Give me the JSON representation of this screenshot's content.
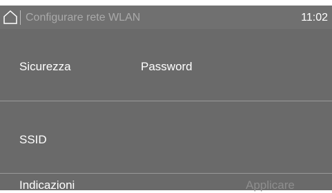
{
  "status_bar": {
    "title": "Configurare rete WLAN",
    "time": "11:02",
    "home_icon": "home-icon"
  },
  "rows": {
    "security": {
      "label": "Sicurezza",
      "value": "Password"
    },
    "ssid": {
      "label": "SSID",
      "value": ""
    }
  },
  "footer": {
    "info_label": "Indicazioni",
    "apply_label": "Applicare"
  },
  "colors": {
    "background": "#6a6a6a",
    "text": "#ffffff",
    "disabled_text": "#8e8e8e",
    "title_text": "#a9a9a9"
  }
}
